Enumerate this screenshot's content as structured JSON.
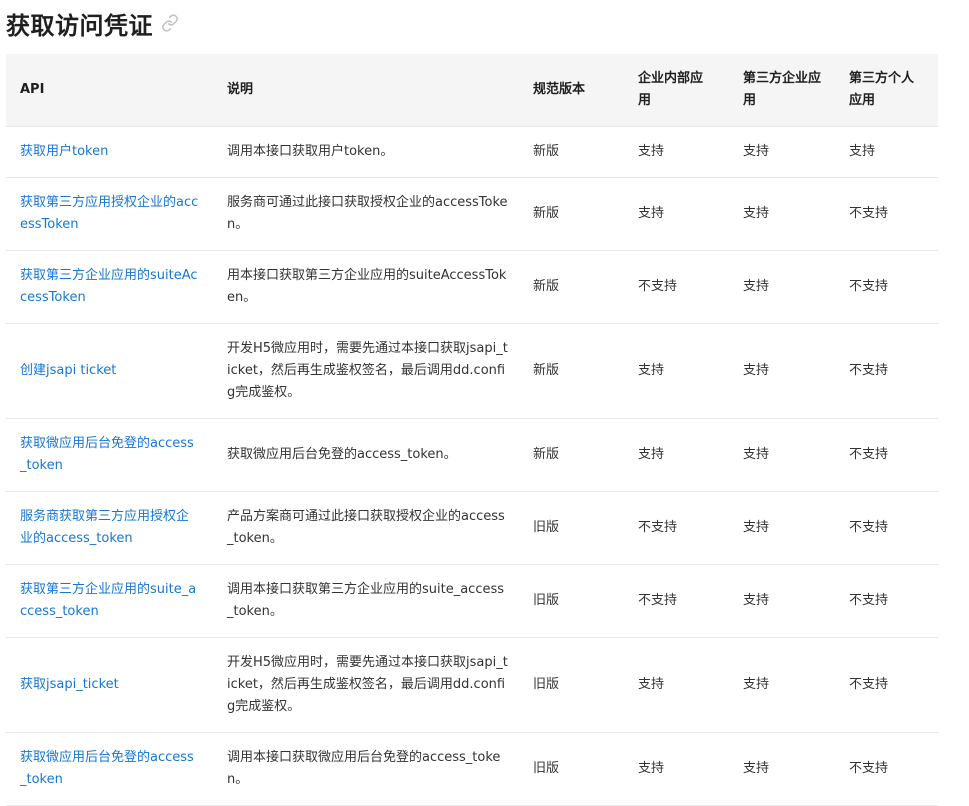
{
  "page": {
    "title": "获取访问凭证",
    "link_icon": "link-icon"
  },
  "table": {
    "headers": [
      "API",
      "说明",
      "规范版本",
      "企业内部应用",
      "第三方企业应用",
      "第三方个人应用"
    ],
    "rows": [
      {
        "api": "获取用户token",
        "desc": "调用本接口获取用户token。",
        "version": "新版",
        "internal": "支持",
        "third_enterprise": "支持",
        "third_personal": "支持"
      },
      {
        "api": "获取第三方应用授权企业的accessToken",
        "desc": "服务商可通过此接口获取授权企业的accessToken。",
        "version": "新版",
        "internal": "支持",
        "third_enterprise": "支持",
        "third_personal": "不支持"
      },
      {
        "api": "获取第三方企业应用的suiteAccessToken",
        "desc": "用本接口获取第三方企业应用的suiteAccessToken。",
        "version": "新版",
        "internal": "不支持",
        "third_enterprise": "支持",
        "third_personal": "不支持"
      },
      {
        "api": "创建jsapi ticket",
        "desc": "开发H5微应用时，需要先通过本接口获取jsapi_ticket，然后再生成鉴权签名，最后调用dd.config完成鉴权。",
        "version": "新版",
        "internal": "支持",
        "third_enterprise": "支持",
        "third_personal": "不支持"
      },
      {
        "api": "获取微应用后台免登的access_token",
        "desc": "获取微应用后台免登的access_token。",
        "version": "新版",
        "internal": "支持",
        "third_enterprise": "支持",
        "third_personal": "不支持"
      },
      {
        "api": "服务商获取第三方应用授权企业的access_token",
        "desc": "产品方案商可通过此接口获取授权企业的access_token。",
        "version": "旧版",
        "internal": "不支持",
        "third_enterprise": "支持",
        "third_personal": "不支持"
      },
      {
        "api": "获取第三方企业应用的suite_access_token",
        "desc": "调用本接口获取第三方企业应用的suite_access_token。",
        "version": "旧版",
        "internal": "不支持",
        "third_enterprise": "支持",
        "third_personal": "不支持"
      },
      {
        "api": "获取jsapi_ticket",
        "desc": "开发H5微应用时，需要先通过本接口获取jsapi_ticket，然后再生成鉴权签名，最后调用dd.config完成鉴权。",
        "version": "旧版",
        "internal": "支持",
        "third_enterprise": "支持",
        "third_personal": "不支持"
      },
      {
        "api": "获取微应用后台免登的access_token",
        "desc": "调用本接口获取微应用后台免登的access_token。",
        "version": "旧版",
        "internal": "支持",
        "third_enterprise": "支持",
        "third_personal": "不支持"
      }
    ]
  },
  "colors": {
    "link": "#1677d2",
    "header_bg": "#f5f5f5",
    "border": "#e8e8e8"
  }
}
